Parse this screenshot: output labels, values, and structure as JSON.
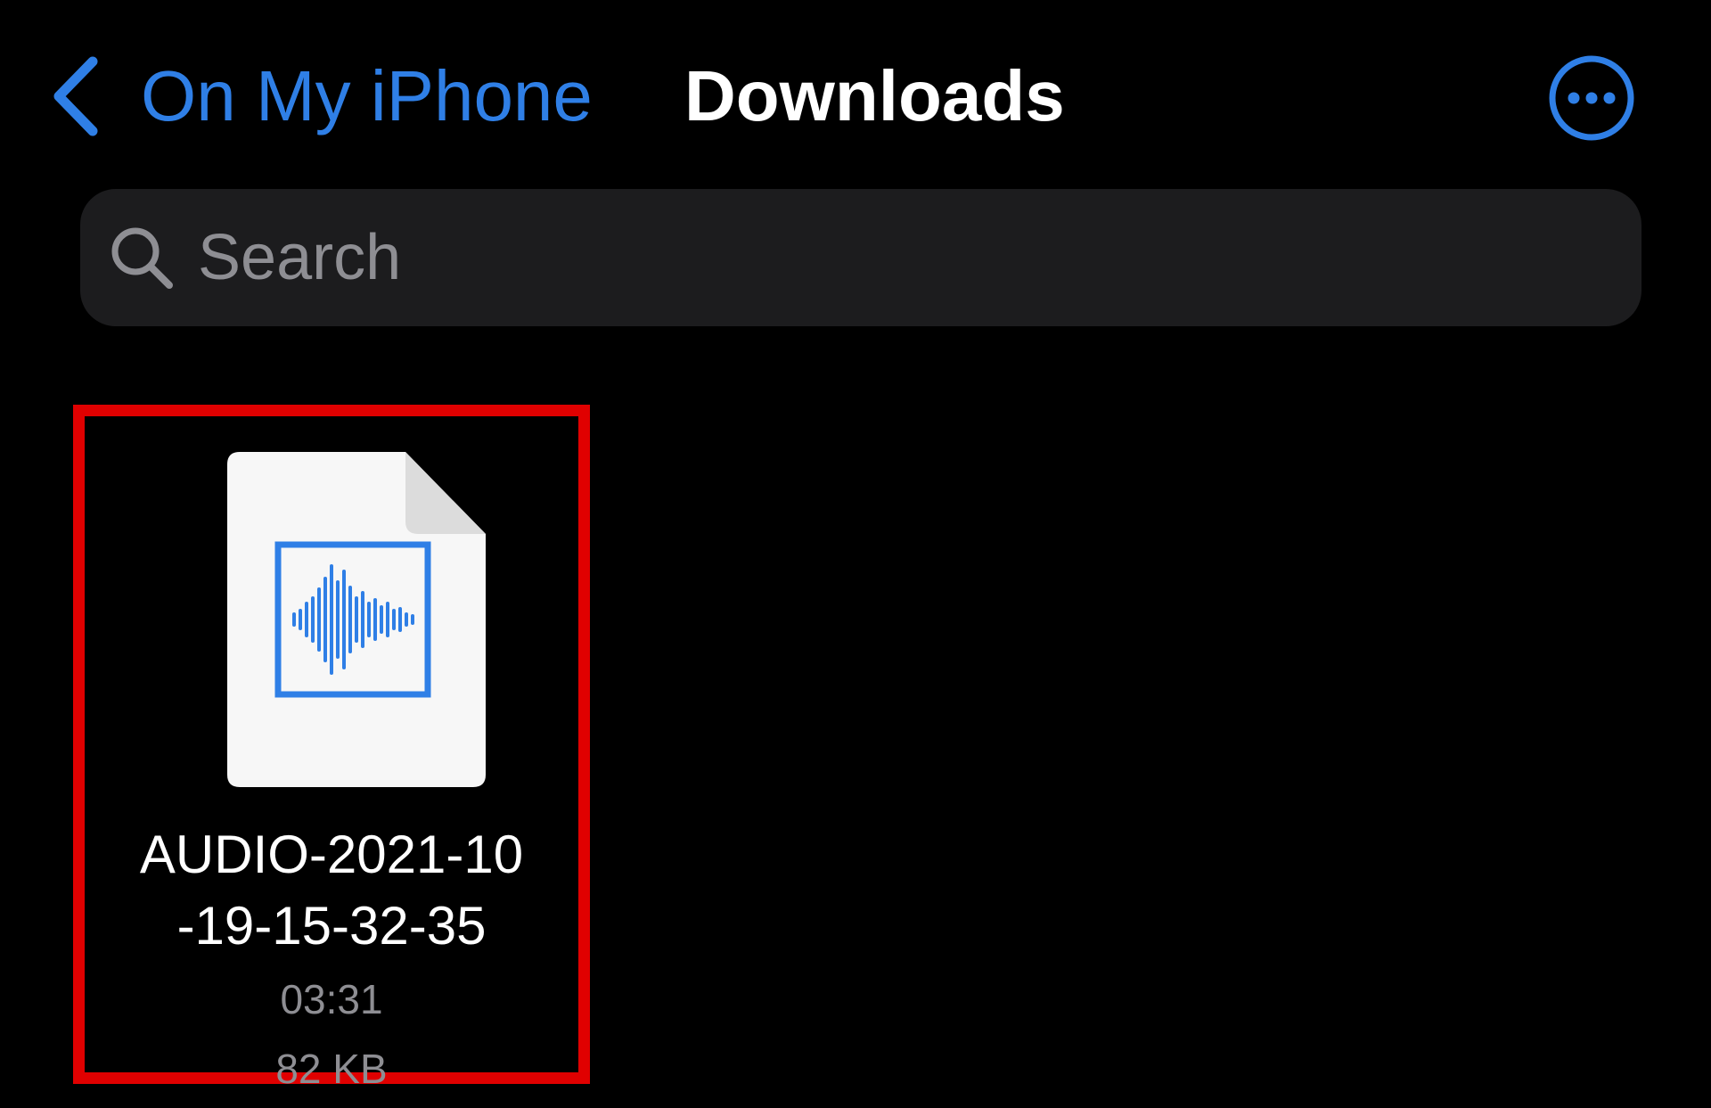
{
  "colors": {
    "background": "#000000",
    "accent": "#2f7fe6",
    "search_field": "#1c1c1e",
    "secondary_text": "#8e8e93",
    "selection_outline": "#e00000"
  },
  "nav": {
    "back_label": "On My iPhone",
    "back_icon": "chevron-left-icon",
    "title": "Downloads",
    "more_icon": "ellipsis-circle-icon"
  },
  "search": {
    "placeholder": "Search",
    "icon": "search-icon"
  },
  "files": [
    {
      "name_line_1": "AUDIO-2021-10",
      "name_line_2": "-19-15-32-35",
      "duration": "03:31",
      "size": "82 KB",
      "icon": "audio-waveform-file-icon",
      "selected": true
    }
  ]
}
